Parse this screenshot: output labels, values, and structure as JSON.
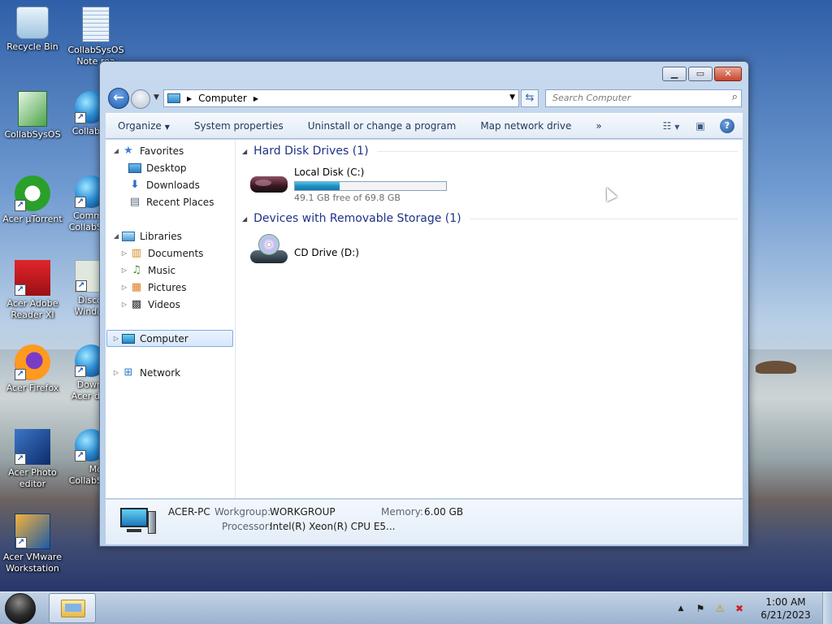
{
  "desktop": {
    "icons": [
      {
        "label": "Recycle Bin"
      },
      {
        "label": "CollabSysOS Note rea"
      },
      {
        "label": "CollabSysOS"
      },
      {
        "label": "CollabS"
      },
      {
        "label": "Acer µTorrent"
      },
      {
        "label": "Comm CollabS"
      },
      {
        "label": "Acer Adobe Reader XI"
      },
      {
        "label": "Disco Windo"
      },
      {
        "label": "Acer Firefox"
      },
      {
        "label": "Down Acer di"
      },
      {
        "label": "Acer Photo editor"
      },
      {
        "label": "Mo CollabS"
      },
      {
        "label": "Acer VMware Workstation"
      }
    ]
  },
  "window": {
    "address": {
      "segment": "Computer"
    },
    "search": {
      "placeholder": "Search Computer"
    },
    "toolbar": {
      "organize": "Organize",
      "system_properties": "System properties",
      "uninstall": "Uninstall or change a program",
      "map_drive": "Map network drive",
      "more": "»"
    },
    "nav": {
      "favorites": "Favorites",
      "desktop": "Desktop",
      "downloads": "Downloads",
      "recent": "Recent Places",
      "libraries": "Libraries",
      "documents": "Documents",
      "music": "Music",
      "pictures": "Pictures",
      "videos": "Videos",
      "computer": "Computer",
      "network": "Network"
    },
    "groups": {
      "hdd_title": "Hard Disk Drives (1)",
      "removable_title": "Devices with Removable Storage (1)"
    },
    "drives": {
      "c": {
        "name": "Local Disk (C:)",
        "free_text": "49.1 GB free of 69.8 GB",
        "used_fraction": 0.297
      },
      "d": {
        "name": "CD Drive (D:)"
      }
    },
    "details": {
      "name": "ACER-PC",
      "workgroup_label": "Workgroup:",
      "workgroup_value": "WORKGROUP",
      "memory_label": "Memory:",
      "memory_value": "6.00 GB",
      "processor_label": "Processor:",
      "processor_value": "Intel(R) Xeon(R) CPU E5..."
    }
  },
  "taskbar": {
    "time": "1:00 AM",
    "date": "6/21/2023"
  },
  "colors": {
    "group_title": "#1e3287",
    "capacity_fill": "#1d8fc4",
    "selection": "#d5e7fb"
  }
}
